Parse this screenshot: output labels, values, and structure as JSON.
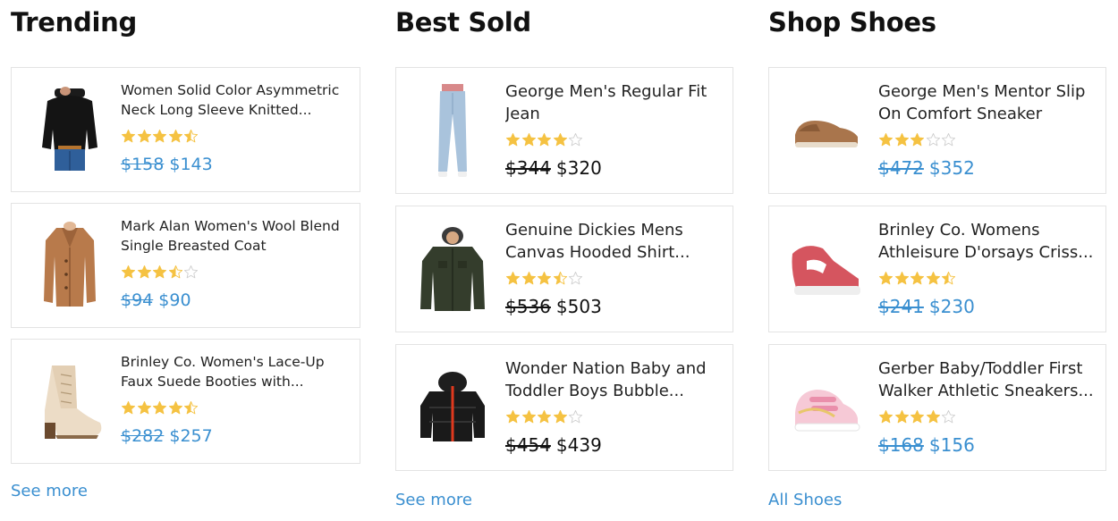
{
  "colors": {
    "link": "#3a8fd0",
    "star": "#f5c242",
    "star_empty": "#cfcfcf"
  },
  "columns": [
    {
      "id": "trending",
      "title": "Trending",
      "footer_link": "See more",
      "items": [
        {
          "name": "Women Solid Color Asymmetric Neck Long Sleeve Knitted...",
          "rating": 4.5,
          "old_price": "$158",
          "price": "$143",
          "image": "black-sweater-image"
        },
        {
          "name": "Mark Alan Women's Wool Blend Single Breasted Coat",
          "rating": 3.5,
          "old_price": "$94",
          "price": "$90",
          "image": "camel-coat-image"
        },
        {
          "name": "Brinley Co. Women's Lace-Up Faux Suede Booties with...",
          "rating": 4.5,
          "old_price": "$282",
          "price": "$257",
          "image": "suede-bootie-image"
        }
      ]
    },
    {
      "id": "best-sold",
      "title": "Best Sold",
      "footer_link": "See more",
      "items": [
        {
          "name": "George Men's Regular Fit Jean",
          "rating": 4,
          "old_price": "$344",
          "price": "$320",
          "image": "jeans-image"
        },
        {
          "name": "Genuine Dickies Mens Canvas Hooded Shirt...",
          "rating": 3.5,
          "old_price": "$536",
          "price": "$503",
          "image": "hooded-shirt-jacket-image"
        },
        {
          "name": "Wonder Nation Baby and Toddler Boys Bubble...",
          "rating": 4,
          "old_price": "$454",
          "price": "$439",
          "image": "bubble-jacket-image"
        }
      ]
    },
    {
      "id": "shop-shoes",
      "title": "Shop Shoes",
      "footer_link": "All Shoes",
      "items": [
        {
          "name": "George Men's Mentor Slip On Comfort Sneaker",
          "rating": 3,
          "old_price": "$472",
          "price": "$352",
          "image": "slip-on-sneaker-image"
        },
        {
          "name": "Brinley Co. Womens Athleisure D'orsays Criss...",
          "rating": 4.5,
          "old_price": "$241",
          "price": "$230",
          "image": "pink-dorsay-shoe-image"
        },
        {
          "name": "Gerber Baby/Toddler First Walker Athletic Sneakers...",
          "rating": 4,
          "old_price": "$168",
          "price": "$156",
          "image": "toddler-sneaker-image"
        }
      ]
    }
  ]
}
